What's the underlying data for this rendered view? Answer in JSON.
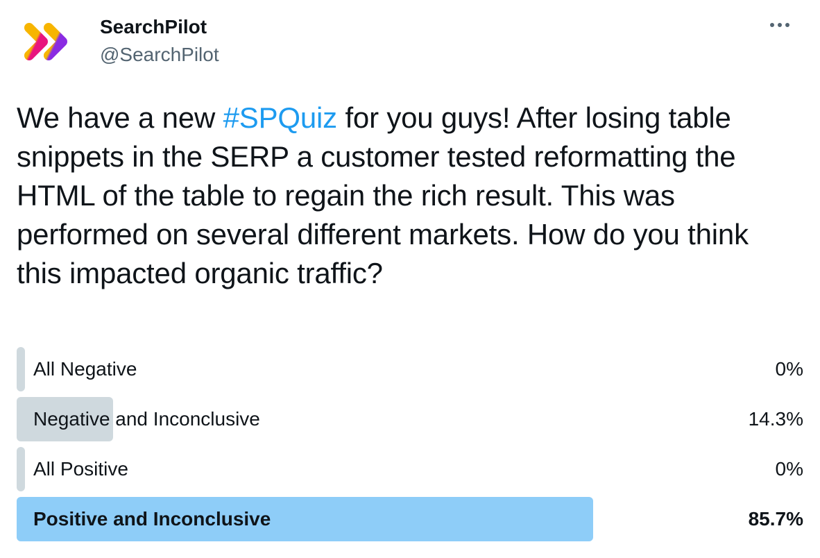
{
  "account": {
    "name": "SearchPilot",
    "handle": "@SearchPilot",
    "avatar_icon": "searchpilot-chevrons-logo"
  },
  "more_icon": "ellipsis-icon",
  "tweet": {
    "text_before": "We have a new ",
    "hashtag": "#SPQuiz",
    "text_after": " for you guys! After losing table snippets in the SERP a customer tested reformatting the HTML of the table to regain the rich result. This was performed on several different markets. How do you think this impacted organic traffic?"
  },
  "poll": {
    "options": [
      {
        "label": "All Negative",
        "percent_text": "0%",
        "percent": 0
      },
      {
        "label": "Negative and Inconclusive",
        "percent_text": "14.3%",
        "percent": 14.3
      },
      {
        "label": "All Positive",
        "percent_text": "0%",
        "percent": 0
      },
      {
        "label": "Positive and Inconclusive",
        "percent_text": "85.7%",
        "percent": 85.7
      }
    ]
  },
  "colors": {
    "accent": "#1d9bf0",
    "bar_default": "#cfd9de",
    "bar_winner": "#8ecdf8",
    "logo_yellow": "#f7b500",
    "logo_pink": "#e8157e",
    "logo_purple": "#8a2be2"
  }
}
